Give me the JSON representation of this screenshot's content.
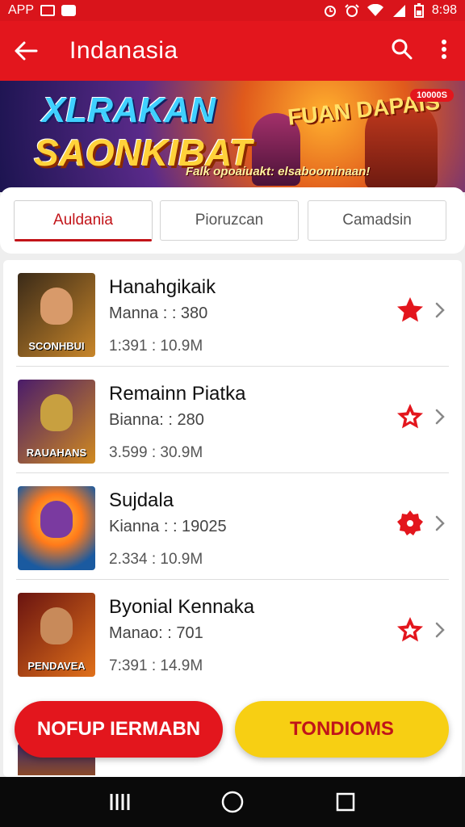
{
  "status_bar": {
    "left_label": "APP",
    "time": "8:98"
  },
  "app_bar": {
    "title": "Indanasia"
  },
  "banner": {
    "line1": "XLRAKAN",
    "line2": "SAONKIBAT",
    "side_title": "FUAN DAPAIS",
    "tagline": "Falk opoaiuakt: elsaboominaan!",
    "badge": "10000S"
  },
  "tabs": [
    {
      "label": "Auldania"
    },
    {
      "label": "Pioruzcan"
    },
    {
      "label": "Camadsin"
    }
  ],
  "games": [
    {
      "name": "Hanahgikaik",
      "meta1": "Manna : : 380",
      "meta2": "1:391 : 10.9M",
      "thumb_caption": "SCONHBUI",
      "colors": [
        "#3a2a18",
        "#c8862a"
      ],
      "star_style": "filled"
    },
    {
      "name": "Remainn Piatka",
      "meta1": "Bianna: : 280",
      "meta2": "3.599 : 30.9M",
      "thumb_caption": "RAUAHANS",
      "colors": [
        "#4a1c6a",
        "#d08a20"
      ],
      "star_style": "outline"
    },
    {
      "name": "Sujdala",
      "meta1": "Kianna : : 19025",
      "meta2": "2.334 : 10.9M",
      "thumb_caption": "",
      "colors": [
        "#1a5aa0",
        "#ff9a1a"
      ],
      "star_style": "badge"
    },
    {
      "name": "Byonial Kennaka",
      "meta1": "Manao: : 701",
      "meta2": "7:391 : 14.9M",
      "thumb_caption": "PENDAVEA",
      "colors": [
        "#6a1410",
        "#e0701a"
      ],
      "star_style": "outline"
    }
  ],
  "actions": {
    "primary": "NOFUP IERMABN",
    "secondary": "TONDIOMS"
  },
  "theme": {
    "primary": "#e3161d",
    "accent": "#f7cf13"
  }
}
